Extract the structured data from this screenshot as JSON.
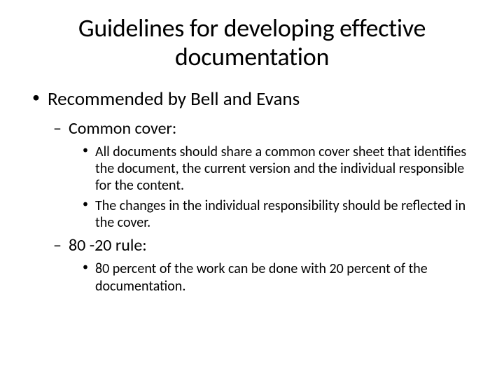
{
  "title": "Guidelines for developing effective documentation",
  "level1": {
    "item0": "Recommended by Bell and Evans"
  },
  "level2": {
    "item0": "Common cover:",
    "item1": "80 -20 rule:"
  },
  "level3": {
    "common0": "All documents should share a common cover sheet that identifies the document, the current version and the individual responsible for the content.",
    "common1": "The changes in the individual responsibility should be reflected in the cover.",
    "rule0": "80 percent of the work can be done with 20 percent of the documentation."
  }
}
